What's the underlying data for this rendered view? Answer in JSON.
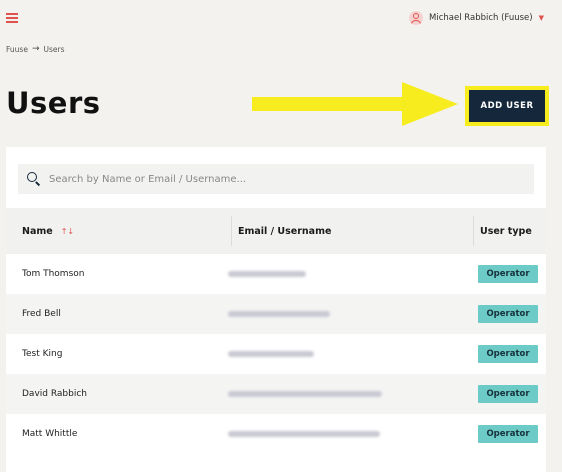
{
  "header": {
    "user_name": "Michael Rabbich (Fuuse)"
  },
  "breadcrumb": {
    "root": "Fuuse",
    "current": "Users"
  },
  "page": {
    "title": "Users",
    "add_user_label": "ADD USER"
  },
  "colors": {
    "accent": "#e0524d",
    "button_bg": "#15283b",
    "highlight": "#f7ec1d",
    "badge": "#6ccbc6"
  },
  "search": {
    "placeholder": "Search by Name or Email / Username..."
  },
  "table": {
    "columns": [
      "Name",
      "Email / Username",
      "User type"
    ],
    "rows": [
      {
        "name": "Tom Thomson",
        "user_type": "Operator"
      },
      {
        "name": "Fred Bell",
        "user_type": "Operator"
      },
      {
        "name": "Test King",
        "user_type": "Operator"
      },
      {
        "name": "David Rabbich",
        "user_type": "Operator"
      },
      {
        "name": "Matt Whittle",
        "user_type": "Operator"
      }
    ]
  }
}
